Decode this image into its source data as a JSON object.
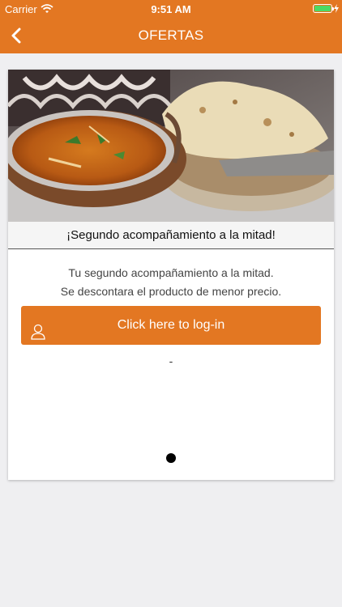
{
  "status_bar": {
    "carrier": "Carrier",
    "time": "9:51 AM",
    "battery_color": "#4cd964"
  },
  "nav": {
    "title": "OFERTAS",
    "back_icon": "chevron-left-icon",
    "background": "#e37722"
  },
  "offer": {
    "image_label": "curry-and-naan-photo",
    "title": "¡Segundo acompañamiento a la mitad!",
    "description_line1": "Tu segundo acompañamiento a la mitad.",
    "description_line2": "Se descontara el producto de menor precio.",
    "login_button_label": "Click here to log-in",
    "login_icon": "user-icon",
    "dash": "-",
    "page_indicator": {
      "pages": 1,
      "current": 1
    }
  }
}
